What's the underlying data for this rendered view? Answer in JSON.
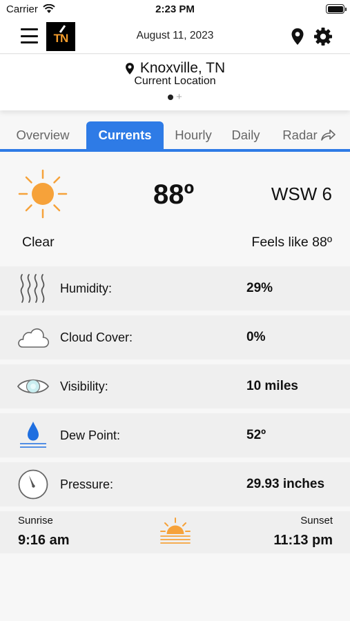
{
  "status_bar": {
    "carrier": "Carrier",
    "time": "2:23 PM"
  },
  "header": {
    "date": "August 11, 2023",
    "logo_text": "TN",
    "icons": [
      "menu-icon",
      "location-pin-icon",
      "settings-gear-icon"
    ]
  },
  "location": {
    "city": "Knoxville, TN",
    "subtitle": "Current Location",
    "plus": "+"
  },
  "tabs": [
    {
      "label": "Overview",
      "active": false
    },
    {
      "label": "Currents",
      "active": true
    },
    {
      "label": "Hourly",
      "active": false
    },
    {
      "label": "Daily",
      "active": false
    },
    {
      "label": "Radar",
      "active": false
    }
  ],
  "current": {
    "temperature": "88º",
    "wind": "WSW 6",
    "condition": "Clear",
    "feels_like": "Feels like 88º",
    "icon": "sunny-icon"
  },
  "details": [
    {
      "label": "Humidity:",
      "value": "29%",
      "icon": "humidity-icon"
    },
    {
      "label": "Cloud Cover:",
      "value": "0%",
      "icon": "cloud-icon"
    },
    {
      "label": "Visibility:",
      "value": "10 miles",
      "icon": "eye-icon"
    },
    {
      "label": "Dew Point:",
      "value": "52º",
      "icon": "droplet-icon"
    },
    {
      "label": "Pressure:",
      "value": "29.93 inches",
      "icon": "gauge-icon"
    }
  ],
  "sun": {
    "sunrise_label": "Sunrise",
    "sunrise_time": "9:16 am",
    "sunset_label": "Sunset",
    "sunset_time": "11:13 pm"
  },
  "colors": {
    "accent": "#2e7be6",
    "sun": "#f6a23a",
    "logo": "#f39c2c"
  }
}
